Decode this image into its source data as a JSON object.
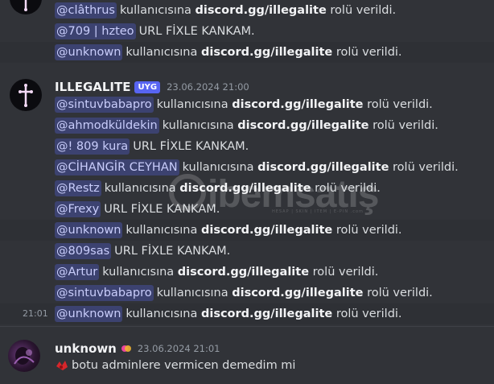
{
  "top_lines": [
    {
      "mention": "@clâthrus",
      "text1": "kullanıcısına",
      "bold": "discord.gg/illegalite",
      "text2": "rolü verildi.",
      "highlight": false
    },
    {
      "mention": "@709 | hzteo",
      "text1": "URL FİXLE KANKAM.",
      "bold": "",
      "text2": "",
      "highlight": false
    },
    {
      "mention": "@unknown",
      "text1": "kullanıcısına",
      "bold": "discord.gg/illegalite",
      "text2": "rolü verildi.",
      "highlight": true
    }
  ],
  "group": {
    "username": "ILLEGALITE",
    "badge": "UYG",
    "time": "23.06.2024 21:00"
  },
  "group_lines": [
    {
      "mention": "@sintuvbabapro",
      "text1": "kullanıcısına",
      "bold": "discord.gg/illegalite",
      "text2": "rolü verildi.",
      "highlight": false
    },
    {
      "mention": "@ahmodküldekin",
      "text1": "kullanıcısına",
      "bold": "discord.gg/illegalite",
      "text2": "rolü verildi.",
      "highlight": false
    },
    {
      "mention": "@! 809 kura",
      "text1": "URL FİXLE KANKAM.",
      "bold": "",
      "text2": "",
      "highlight": false
    },
    {
      "mention": "@CİHANGİR CEYHAN",
      "text1": "kullanıcısına",
      "bold": "discord.gg/illegalite",
      "text2": "rolü verildi.",
      "highlight": false
    },
    {
      "mention": "@Restz",
      "text1": "kullanıcısına",
      "bold": "discord.gg/illegalite",
      "text2": "rolü verildi.",
      "highlight": false
    },
    {
      "mention": "@Frexy",
      "text1": "URL FİXLE KANKAM.",
      "bold": "",
      "text2": "",
      "highlight": false
    },
    {
      "mention": "@unknown",
      "text1": "kullanıcısına",
      "bold": "discord.gg/illegalite",
      "text2": "rolü verildi.",
      "highlight": true
    },
    {
      "mention": "@809sas",
      "text1": "URL FİXLE KANKAM.",
      "bold": "",
      "text2": "",
      "highlight": false
    },
    {
      "mention": "@Artur",
      "text1": "kullanıcısına",
      "bold": "discord.gg/illegalite",
      "text2": "rolü verildi.",
      "highlight": false
    },
    {
      "mention": "@sintuvbabapro",
      "text1": "kullanıcısına",
      "bold": "discord.gg/illegalite",
      "text2": "rolü verildi.",
      "highlight": false
    },
    {
      "mention": "@unknown",
      "text1": "kullanıcısına",
      "bold": "discord.gg/illegalite",
      "text2": "rolü verildi.",
      "highlight": true,
      "side_time": "21:01"
    }
  ],
  "last_message": {
    "username": "unknown",
    "time": "23.06.2024 21:01",
    "text": "botu adminlere vermicen demedim mi"
  },
  "watermark": {
    "brand": "ibemsatış",
    "sub": "HESAP | SKIN | ITEM | E-PIN .com"
  },
  "colors": {
    "background": "#313338",
    "mention_bg": "#3c4270",
    "mention_text": "#c9cdfb",
    "badge": "#5865f2"
  }
}
